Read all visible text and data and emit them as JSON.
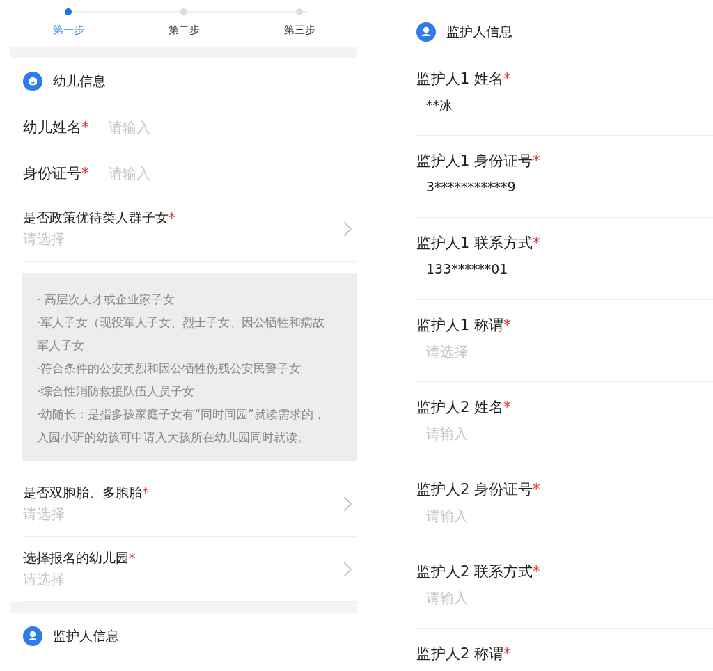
{
  "steps": [
    {
      "label": "第一步",
      "selected": true
    },
    {
      "label": "第二步",
      "selected": false
    },
    {
      "label": "第三步",
      "selected": false
    }
  ],
  "child_section": {
    "title": "幼儿信息",
    "fields": [
      {
        "kind": "input",
        "label": "幼儿姓名",
        "mark": "*",
        "placeholder": "请输入"
      },
      {
        "kind": "input",
        "label": "身份证号",
        "mark": "*",
        "placeholder": "请输入"
      },
      {
        "kind": "select",
        "label": "是否政策优待类人群子女",
        "mark": "*",
        "placeholder": "请选择"
      },
      {
        "kind": "notice",
        "lines": [
          "· 高层次人才或企业家子女",
          "·军人子女（现役军人子女、烈士子女、因公牺牲和病故军人子女",
          "·符合条件的公安英烈和因公牺牲伤残公安民警子女",
          "·综合性消防救援队伍人员子女",
          "·幼随长：是指多孩家庭子女有“同时同园”就读需求的，入园小班的幼孩可申请入大孩所在幼儿园同时就读。"
        ]
      },
      {
        "kind": "select",
        "label": "是否双胞胎、多胞胎",
        "mark": "*",
        "placeholder": "请选择"
      },
      {
        "kind": "select",
        "label": "选择报名的幼儿园",
        "mark": "*",
        "placeholder": "请选择"
      }
    ]
  },
  "guardian_header_left": {
    "title": "监护人信息"
  },
  "guardian_section": {
    "title": "监护人信息",
    "fields": [
      {
        "label": "监护人1 姓名",
        "mark": "*",
        "value": "**冰"
      },
      {
        "label": "监护人1 身份证号",
        "mark": "*",
        "value": "3***********9"
      },
      {
        "label": "监护人1 联系方式",
        "mark": "*",
        "value": "133******01"
      },
      {
        "label": "监护人1 称谓",
        "mark": "*",
        "placeholder": "请选择"
      },
      {
        "label": "监护人2 姓名",
        "mark": "*",
        "placeholder": "请输入"
      },
      {
        "label": "监护人2 身份证号",
        "mark": "*",
        "placeholder": "请输入"
      },
      {
        "label": "监护人2 联系方式",
        "mark": "*",
        "placeholder": "请输入"
      },
      {
        "label": "监护人2 称谓",
        "mark": "*"
      }
    ]
  }
}
